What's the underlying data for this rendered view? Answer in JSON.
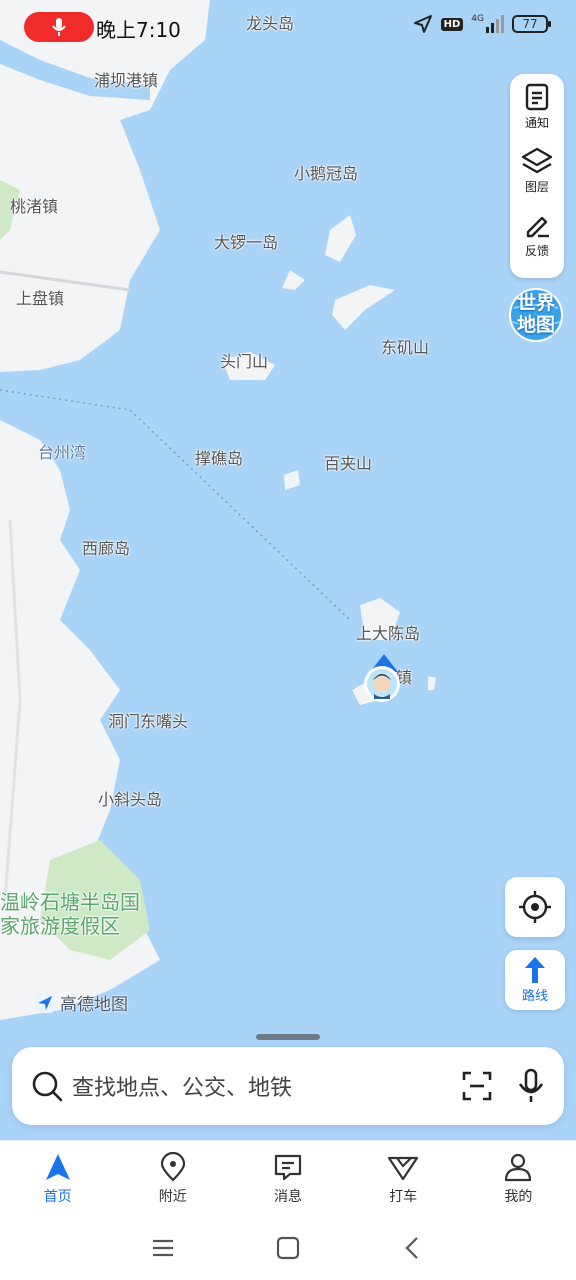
{
  "status_bar": {
    "time": "晚上7:10",
    "network": "4G",
    "hd": "HD",
    "battery": "77"
  },
  "map": {
    "labels": {
      "longtou": "龙头岛",
      "pubagang": "浦坝港镇",
      "taozhu": "桃渚镇",
      "shangpan": "上盘镇",
      "xiaoeguan": "小鹅冠岛",
      "daluoyi": "大锣一岛",
      "toumenshan": "头门山",
      "dongjishan": "东矶山",
      "taizhouwan": "台州湾",
      "chengjiao": "撑礁岛",
      "baijiashan": "百夹山",
      "xilang": "西廊岛",
      "shangdachen": "上大陈岛",
      "dachenzhen_tail": "镇",
      "dongmen": "洞门东嘴头",
      "xiaoxietou": "小斜头岛",
      "wenling": "温岭石塘半岛国家旅游度假区"
    },
    "logo": "高德地图"
  },
  "tools": {
    "notify": "通知",
    "layers": "图层",
    "feedback": "反馈",
    "world_map": "世界地图"
  },
  "route_button": "路线",
  "search": {
    "placeholder": "查找地点、公交、地铁"
  },
  "bottom_nav": [
    {
      "label": "首页",
      "icon": "navigation-arrow-icon",
      "active": true
    },
    {
      "label": "附近",
      "icon": "location-pin-icon",
      "active": false
    },
    {
      "label": "消息",
      "icon": "message-icon",
      "active": false
    },
    {
      "label": "打车",
      "icon": "taxi-icon",
      "active": false
    },
    {
      "label": "我的",
      "icon": "profile-icon",
      "active": false
    }
  ],
  "colors": {
    "sea": "#a9d3f7",
    "land": "#f3f4f6",
    "accent": "#1a73e8",
    "record": "#f02b2b"
  }
}
